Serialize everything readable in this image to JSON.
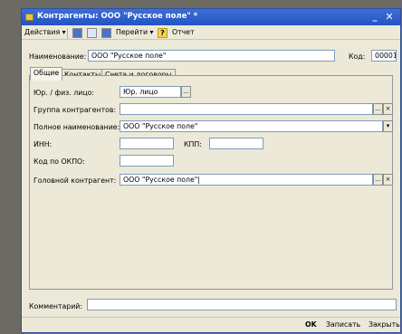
{
  "window": {
    "title": "Контрагенты: ООО \"Русское поле\" *",
    "minimize": "_",
    "maximize": "□",
    "close": "✕"
  },
  "toolbar": {
    "actions": "Действия ▾",
    "goto": "Перейти ▾",
    "help": "?",
    "report": "Отчет"
  },
  "header": {
    "name_label": "Наименование:",
    "name_value": "ООО \"Русское поле\"",
    "code_label": "Код:",
    "code_value": "00001"
  },
  "tabs": [
    {
      "label": "Общие"
    },
    {
      "label": "Контакты"
    },
    {
      "label": "Счета и договоры"
    }
  ],
  "form": {
    "legal_label": "Юр. / физ. лицо:",
    "legal_value": "Юр. лицо",
    "group_label": "Группа контрагентов:",
    "group_value": "",
    "fullname_label": "Полное наименование:",
    "fullname_value": "ООО \"Русское поле\"",
    "inn_label": "ИНН:",
    "inn_value": "",
    "kpp_label": "КПП:",
    "kpp_value": "",
    "okpo_label": "Код по ОКПО:",
    "okpo_value": "",
    "head_label": "Головной контрагент:",
    "head_value": "ООО \"Русское поле\"|"
  },
  "comment": {
    "label": "Комментарий:",
    "value": ""
  },
  "buttons": {
    "ok": "OK",
    "save": "Записать",
    "close": "Закрыть"
  },
  "glyphs": {
    "ellipsis": "...",
    "clear": "×",
    "dropdown": "▾"
  }
}
